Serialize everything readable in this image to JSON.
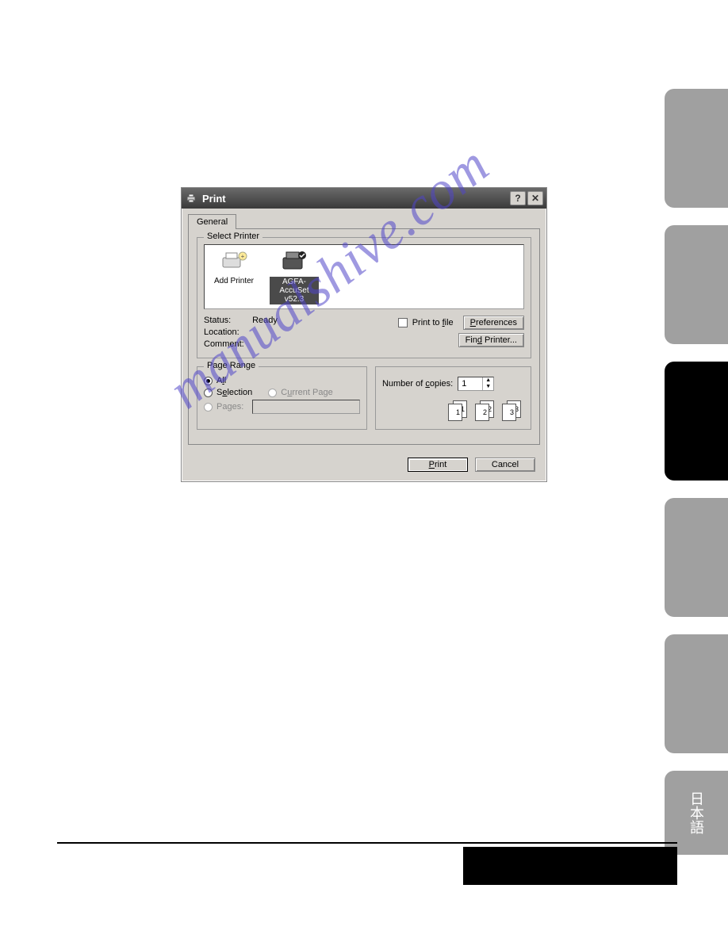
{
  "watermark": "manualshive.com",
  "dialog": {
    "title": "Print",
    "tabs": {
      "general": "General"
    },
    "select_printer": {
      "title": "Select Printer",
      "add_printer": "Add Printer",
      "printer_name": "AGFA-AccuSet v52.3"
    },
    "status": {
      "status_label": "Status:",
      "status_value": "Ready",
      "location_label": "Location:",
      "comment_label": "Comment:"
    },
    "right": {
      "print_to_file": "Print to file",
      "preferences": "Preferences",
      "find_printer": "Find Printer..."
    },
    "page_range": {
      "title": "Page Range",
      "all": "All",
      "selection": "Selection",
      "current_page": "Current Page",
      "pages": "Pages:"
    },
    "copies": {
      "label": "Number of copies:",
      "value": "1",
      "pair1": "1",
      "pair2": "2",
      "pair3": "3"
    },
    "buttons": {
      "print": "Print",
      "cancel": "Cancel"
    }
  }
}
